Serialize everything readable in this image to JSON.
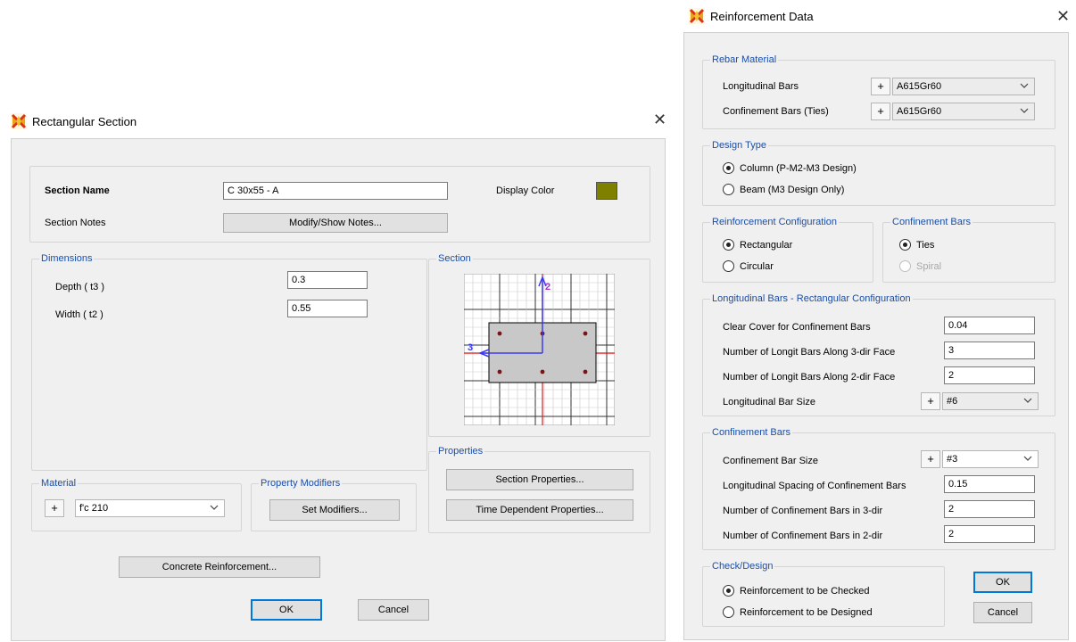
{
  "rect_dialog": {
    "title": "Rectangular Section",
    "section_name_label": "Section Name",
    "section_name_value": "C 30x55 - A",
    "display_color_label": "Display Color",
    "section_notes_label": "Section Notes",
    "modify_notes_button": "Modify/Show Notes...",
    "dimensions_group": "Dimensions",
    "depth_label": "Depth  ( t3 )",
    "depth_value": "0.3",
    "width_label": "Width  ( t2 )",
    "width_value": "0.55",
    "section_group": "Section",
    "properties_group": "Properties",
    "section_properties_button": "Section Properties...",
    "time_dependent_button": "Time Dependent Properties...",
    "material_group": "Material",
    "material_plus": "+",
    "material_value": "f'c 210",
    "property_modifiers_group": "Property Modifiers",
    "set_modifiers_button": "Set Modifiers...",
    "concrete_reinforcement_button": "Concrete Reinforcement...",
    "ok_button": "OK",
    "cancel_button": "Cancel",
    "axis_label_2": "2",
    "axis_label_3": "3",
    "display_color_hex": "#7f7f00"
  },
  "reinf_dialog": {
    "title": "Reinforcement Data",
    "rebar_material_group": "Rebar Material",
    "longitudinal_bars_label": "Longitudinal Bars",
    "longitudinal_bars_value": "A615Gr60",
    "confinement_ties_label": "Confinement Bars  (Ties)",
    "confinement_ties_value": "A615Gr60",
    "plus": "+",
    "design_type_group": "Design Type",
    "design_column": "Column  (P-M2-M3 Design)",
    "design_beam": "Beam  (M3 Design Only)",
    "reinf_config_group": "Reinforcement Configuration",
    "config_rectangular": "Rectangular",
    "config_circular": "Circular",
    "confinement_bars_group": "Confinement Bars",
    "conf_ties": "Ties",
    "conf_spiral": "Spiral",
    "long_bars_group": "Longitudinal Bars - Rectangular Configuration",
    "clear_cover_label": "Clear Cover for Confinement Bars",
    "clear_cover_value": "0.04",
    "bars_3dir_label": "Number of Longit Bars Along 3-dir Face",
    "bars_3dir_value": "3",
    "bars_2dir_label": "Number of Longit Bars Along 2-dir Face",
    "bars_2dir_value": "2",
    "long_bar_size_label": "Longitudinal Bar Size",
    "long_bar_size_value": "#6",
    "confinement_group": "Confinement Bars",
    "conf_bar_size_label": "Confinement Bar Size",
    "conf_bar_size_value": "#3",
    "long_spacing_label": "Longitudinal Spacing of Confinement Bars",
    "long_spacing_value": "0.15",
    "conf_3dir_label": "Number of Confinement Bars in 3-dir",
    "conf_3dir_value": "2",
    "conf_2dir_label": "Number of Confinement Bars in 2-dir",
    "conf_2dir_value": "2",
    "check_design_group": "Check/Design",
    "check_option": "Reinforcement to be Checked",
    "design_option": "Reinforcement to be Designed",
    "ok_button": "OK",
    "cancel_button": "Cancel"
  },
  "colors": {
    "group_label": "#1a4ea8",
    "dialog_bg": "#f0f0f0",
    "default_button_border": "#0078d7",
    "section_fill": "#c8c8c8",
    "rebar_dot": "#7a1515",
    "axis_2": "#3a3af0",
    "axis_3": "#3a3af0",
    "axis_red": "#e01b1b"
  }
}
